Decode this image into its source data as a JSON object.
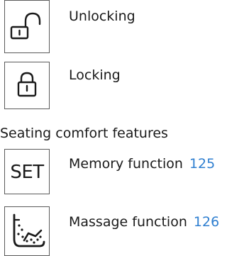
{
  "items": [
    {
      "label": "Unlocking",
      "icon": "unlock-icon"
    },
    {
      "label": "Locking",
      "icon": "lock-icon"
    }
  ],
  "section": {
    "heading": "Seating comfort features",
    "items": [
      {
        "label": "Memory function",
        "page": "125",
        "icon": "set-icon",
        "icon_text": "SET"
      },
      {
        "label": "Massage function",
        "page": "126",
        "icon": "massage-seat-icon"
      }
    ]
  },
  "colors": {
    "text": "#1a1a1a",
    "link": "#2f7fd0",
    "border": "#5a5a5a"
  }
}
